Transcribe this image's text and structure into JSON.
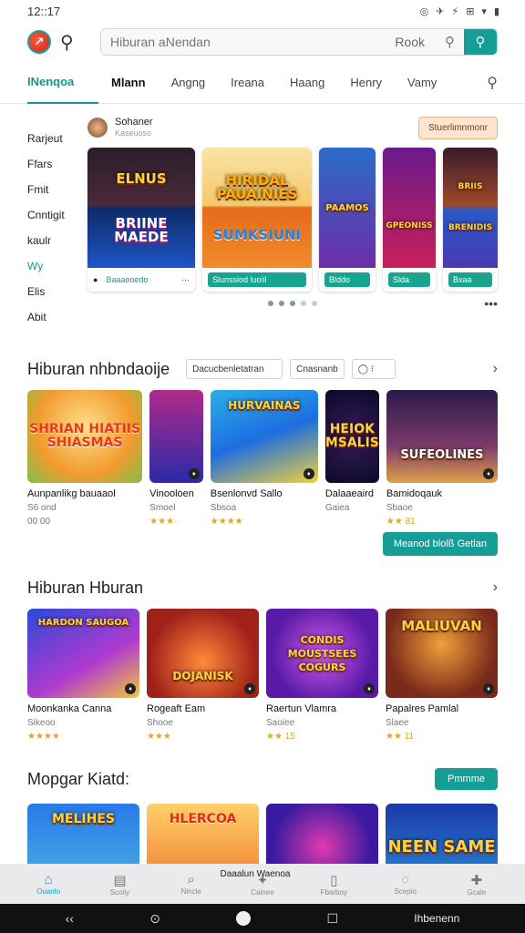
{
  "status": {
    "time": "12::17",
    "icons": [
      "◎",
      "✈",
      "⚡",
      "⊞",
      "▾",
      "▮"
    ]
  },
  "header": {
    "search_placeholder": "Hiburan aNendan",
    "search_button_label": "Rook"
  },
  "tabs": [
    "INenqoa",
    "Mlann",
    "Angng",
    "Ireana",
    "Haang",
    "Henry",
    "Vamy"
  ],
  "sidebar": [
    "Rarjeut",
    "Ffars",
    "Fmit",
    "Cnntigit",
    "kaulr",
    "Wy",
    "Elis",
    "Abit"
  ],
  "featured": {
    "name": "Sohaner",
    "sub": "Kaseuoso",
    "action": "Stuerlimnmonr",
    "cards": [
      {
        "top": "ELNUS",
        "bottom": "BRIINE MAEDE",
        "footer": "Baaaooedo"
      },
      {
        "top": "HIRIDAL PAUAINIES",
        "bottom": "SUMKSIUNI",
        "footer": "Slunssiod luoiil"
      },
      {
        "top": "PAAMOS",
        "bottom": "",
        "footer": "Blddo"
      },
      {
        "top": "",
        "bottom": "GPEONISS",
        "footer": "Slda"
      },
      {
        "top": "BRIIS",
        "bottom": "BRENIDIS",
        "footer": "Bxaa"
      }
    ]
  },
  "section1": {
    "title": "Hiburan nhbndaoije",
    "filter1": "Dacucbenletatran",
    "filter2": "Cnasnanb",
    "filter3": "◯  ⁝",
    "games": [
      {
        "title": "SHRIAN HIATIIS SHIASMAS",
        "name": "Aunpanlikg bauaaol",
        "sub": "S6 ond",
        "rating": "00 00"
      },
      {
        "title": "",
        "name": "Vinooloen",
        "sub": "Smoel",
        "rating": "★★★·"
      },
      {
        "title": "HURVAINAS",
        "name": "Bsenlonvd Sallo",
        "sub": "Sbsoa",
        "rating": "★★★★"
      },
      {
        "title": "HEIOK MSALIS",
        "name": "Dalaaeaird",
        "sub": "Gaiea",
        "rating": ""
      },
      {
        "title": "SUFEOLINES",
        "name": "Bamidoqauk",
        "sub": "Sbaoe",
        "rating": "★★ 81"
      }
    ],
    "cta": "Meanod blolß Getlan"
  },
  "section2": {
    "title": "Hiburan Hburan",
    "games": [
      {
        "title": "HARDON SAUGOA",
        "name": "Moonkanka Canna",
        "sub": "Sikeoo",
        "rating": "★★★★"
      },
      {
        "title": "DOJANISK",
        "name": "Rogeaft Eam",
        "sub": "Shooe",
        "rating": "★★★"
      },
      {
        "title": "CONDIS MOUSTSEES COGURS",
        "name": "Raertun Vlamra",
        "sub": "Saoiee",
        "rating": "★★ 15"
      },
      {
        "title": "MALIUVAN",
        "name": "Papalres Pamlal",
        "sub": "Slaee",
        "rating": "★★ 11"
      }
    ]
  },
  "section3": {
    "title": "Mopgar Kiatd:",
    "button": "Pmmme",
    "games": [
      {
        "title": "MELIHES"
      },
      {
        "title": "HLERCOA"
      },
      {
        "title": ""
      },
      {
        "title": "NEEN SAME"
      }
    ]
  },
  "bottom_nav": {
    "toast": "Daaalun Waenoa",
    "items": [
      {
        "label": "Ouanlo",
        "icon": "⌂"
      },
      {
        "label": "Scoliy",
        "icon": "▤"
      },
      {
        "label": "Nincle",
        "icon": "⌕"
      },
      {
        "label": "Cainee",
        "icon": "✦"
      },
      {
        "label": "Fbarboy",
        "icon": "▯"
      },
      {
        "label": "Scepio",
        "icon": "◌"
      },
      {
        "label": "Gcale",
        "icon": "✚"
      }
    ]
  },
  "system_nav": {
    "back": "‹‹",
    "recent": "☐",
    "label": "Ihbenenn"
  }
}
